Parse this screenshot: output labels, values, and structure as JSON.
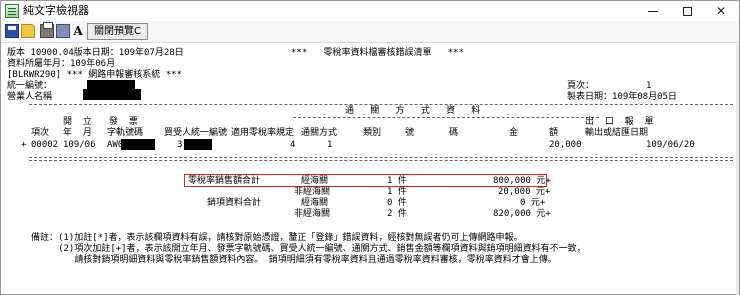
{
  "window": {
    "title": "純文字檢視器"
  },
  "toolbar": {
    "font_label": "A",
    "close_preview_label": "關閉預覽C"
  },
  "report": {
    "header": {
      "line1_left": "版本 10900.04版本日期：109年07月28日",
      "line1_mid": "***   零稅率資料檔審核錯誤清單   ***",
      "line2": "資料所屬年月：109年06月",
      "line3": "[BLRWR290] *** 網路申報審核系統 ***",
      "line4_left": "統一編號：",
      "line4_right_label": "頁次：",
      "line4_right_value": "1",
      "line5_left": "營業人名稱",
      "line5_right": "製表日期：109年08月05日"
    },
    "table_header": {
      "customs_title": "通   關   方   式   資   料",
      "col_item": "項次",
      "col_open_top": "開  立",
      "col_open_bottom": "年  月",
      "col_invoice_top": "發  票",
      "col_invoice_bottom": "字軌號碼",
      "col_buyer": "買受人統一編號",
      "col_rule": "適用零稅率規定",
      "col_customs_method": "通關方式",
      "col_category": "類別",
      "col_number": "號",
      "col_code": "碼",
      "col_amount_a": "金",
      "col_amount_b": "額",
      "col_export_top": "出  口  報  單",
      "col_export_bottom": "輸出或結匯日期"
    },
    "rows": [
      {
        "marker": "+",
        "item": "00002",
        "period": "109/06",
        "invoice": "AW0",
        "buyer": "3",
        "rule": "4",
        "customs_method": "1",
        "amount": "20,000",
        "export_date": "109/06/20"
      }
    ],
    "summary": {
      "zero_rate_label": "零稅率銷售額合計",
      "sales_label": "銷項資料合計",
      "lines": [
        {
          "type": "經海關",
          "count": "1 件",
          "amount": "800,000 元+"
        },
        {
          "type": "非經海關",
          "count": "1 件",
          "amount": "20,000 元+"
        },
        {
          "type": "經海關",
          "count": "0 件",
          "amount": "0 元+"
        },
        {
          "type": "非經海關",
          "count": "2 件",
          "amount": "820,000 元+"
        }
      ]
    },
    "notes": {
      "line1": "備註：(1)加註[*]者，表示該欄項資料有誤，請核對原始憑證，釐正「登錄」錯誤資料，經核對無誤者仍可上傳網路申報。",
      "line2": "     (2)項次加註[+]者，表示該開立年月、發票字軌號碼、買受人統一編號、通關方式、銷售金額等欄項資料與銷項明細資料有不一致，",
      "line3": "        請核對銷項明細資料與零稅率銷售額資料內容。 銷項明細須有零稅率資料且通過零稅率資料審核，零稅率資料才會上傳。"
    }
  }
}
